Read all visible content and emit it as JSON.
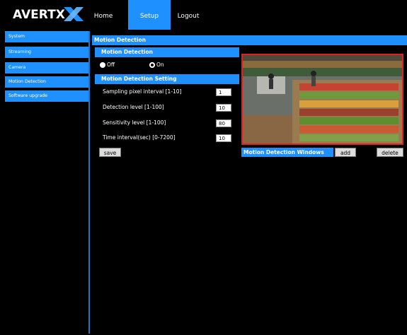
{
  "brand": {
    "logo_text": "AVERTX"
  },
  "nav": {
    "home": "Home",
    "setup": "Setup",
    "logout": "Logout"
  },
  "sidebar": {
    "items": [
      {
        "label": "System"
      },
      {
        "label": "Streaming"
      },
      {
        "label": "Camera"
      },
      {
        "label": "Motion Detection"
      },
      {
        "label": "Software upgrade"
      }
    ]
  },
  "main": {
    "title": "Motion Detection",
    "section_motion": "Motion Detection",
    "radio_off": "Off",
    "radio_on": "On",
    "section_setting": "Motion Detection Setting",
    "fields": [
      {
        "label": "Sampling pixel interval [1-10]",
        "value": "1"
      },
      {
        "label": "Detection level [1-100]",
        "value": "10"
      },
      {
        "label": "Sensitivity level [1-100]",
        "value": "80"
      },
      {
        "label": "Time interval(sec) [0-7200]",
        "value": "10"
      }
    ],
    "save": "save",
    "windows_title": "Motion Detection Windows",
    "add": "add",
    "delete": "delete"
  },
  "colors": {
    "accent": "#1e90ff",
    "preview_border": "#e02020"
  }
}
